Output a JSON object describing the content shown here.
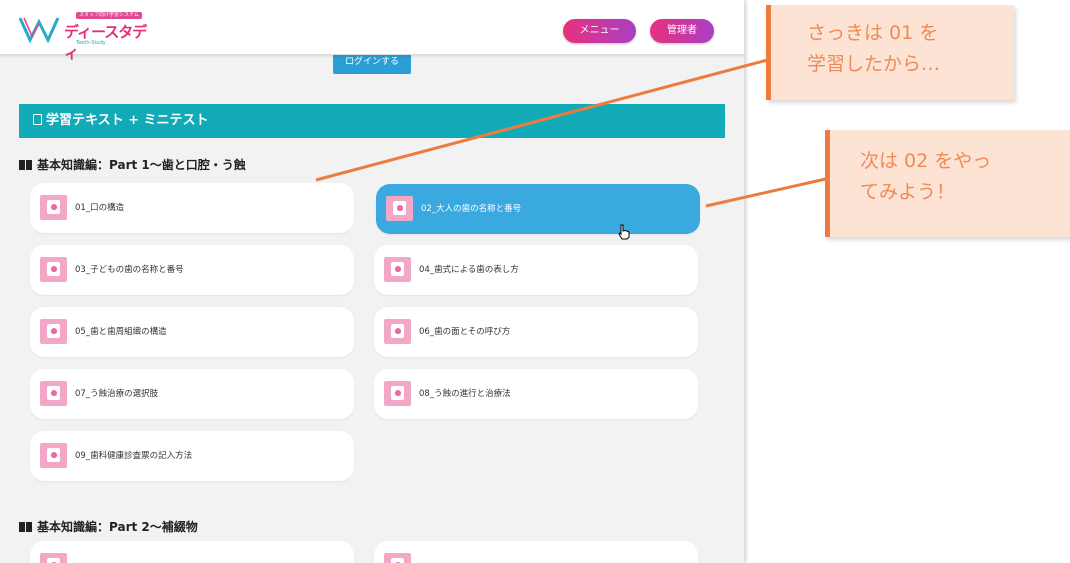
{
  "header": {
    "logo": {
      "top_label": "スタッフ向け学習システム",
      "name": "ディースタディ",
      "tagline": "Teeth-Study"
    },
    "menu_label": "メニュー",
    "admin_label": "管理者",
    "brand_gradient": [
      "#e8317e",
      "#a93fc3"
    ]
  },
  "login_label": "ログインする",
  "section": {
    "title": "学習テキスト + ミニテスト",
    "color": "#13aab8"
  },
  "categories": [
    {
      "title": "基本知識編：Part 1〜歯と口腔・う蝕"
    },
    {
      "title": "基本知識編：Part 2〜補綴物"
    }
  ],
  "lessons": [
    {
      "label": "01_口の構造"
    },
    {
      "label": "02_大人の歯の名称と番号",
      "active": true
    },
    {
      "label": "03_子どもの歯の名称と番号"
    },
    {
      "label": "04_歯式による歯の表し方"
    },
    {
      "label": "05_歯と歯周組織の構造"
    },
    {
      "label": "06_歯の面とその呼び方"
    },
    {
      "label": "07_う蝕治療の選択肢"
    },
    {
      "label": "08_う蝕の進行と治療法"
    },
    {
      "label": "09_歯科健康診査票の記入方法"
    }
  ],
  "callouts": {
    "first": [
      "さっきは 01 を",
      "学習したから…"
    ],
    "second": [
      "次は 02 をやっ",
      "てみよう！"
    ],
    "color": "#ee7b3e"
  },
  "icons": [
    "document-icon",
    "book-icon",
    "lesson-thumbnail-icon",
    "hand-pointer-icon"
  ]
}
